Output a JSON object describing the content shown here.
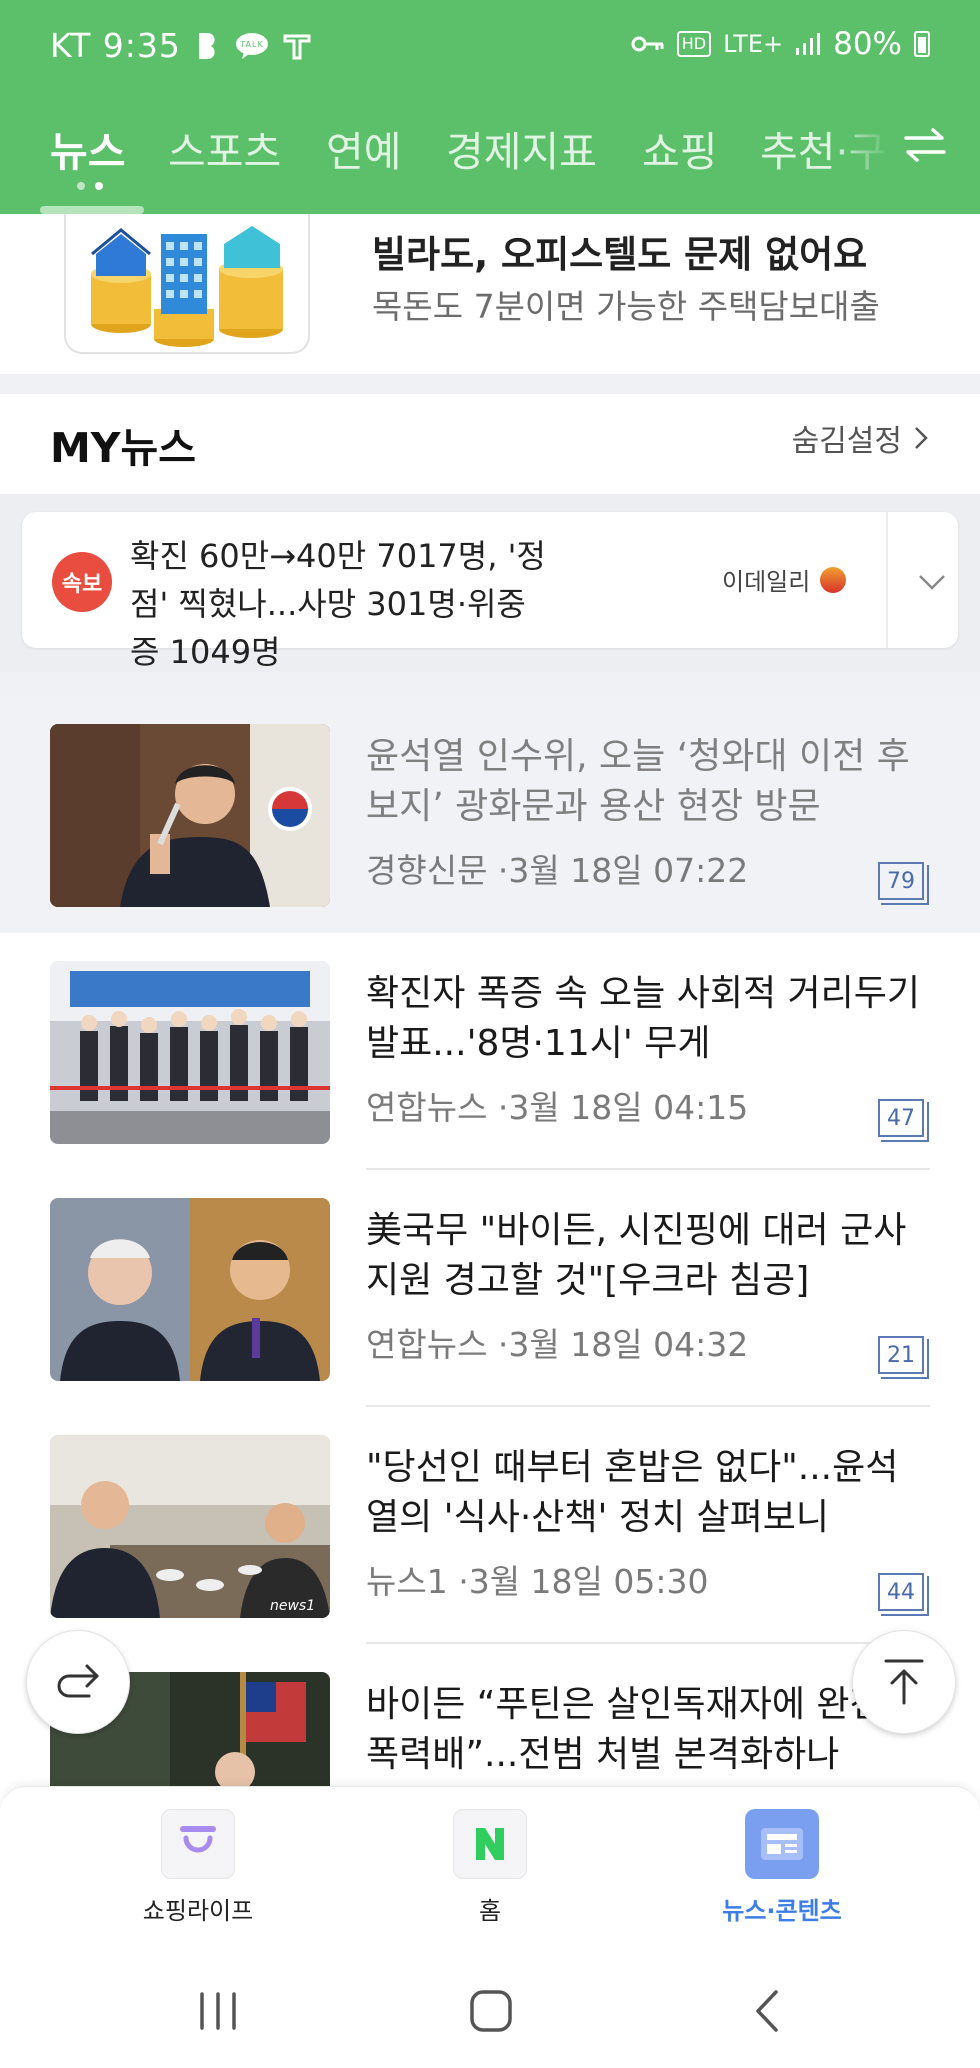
{
  "status_bar": {
    "carrier_time": "KT 9:35",
    "network": "LTE+",
    "hd": "HD",
    "battery": "80%"
  },
  "top_tabs": [
    {
      "label": "뉴스",
      "active": true
    },
    {
      "label": "스포츠",
      "active": false
    },
    {
      "label": "연예",
      "active": false
    },
    {
      "label": "경제지표",
      "active": false
    },
    {
      "label": "쇼핑",
      "active": false
    },
    {
      "label": "추천·구",
      "active": false
    }
  ],
  "ad": {
    "title": "빌라도, 오피스텔도 문제 없어요",
    "subtitle": "목돈도 7분이면 가능한 주택담보대출"
  },
  "my_news": {
    "title": "MY뉴스",
    "hide_setting": "숨김설정"
  },
  "breaking": {
    "badge": "속보",
    "headline": "확진 60만→40만 7017명, '정점' 찍혔나...사망 301명·위중증 1049명",
    "press": "이데일리"
  },
  "news": [
    {
      "title": "윤석열 인수위, 오늘 ‘청와대 이전 후보지’ 광화문과 용산 현장 방문",
      "meta": "경향신문 ·3월 18일 07:22",
      "comments": "79",
      "read": true
    },
    {
      "title": "확진자 폭증 속 오늘 사회적 거리두기 발표...'8명·11시' 무게",
      "meta": "연합뉴스 ·3월 18일 04:15",
      "comments": "47",
      "read": false
    },
    {
      "title": "美국무 \"바이든, 시진핑에 대러 군사지원 경고할 것\"[우크라 침공]",
      "meta": "연합뉴스 ·3월 18일 04:32",
      "comments": "21",
      "read": false
    },
    {
      "title": "\"당선인 때부터 혼밥은 없다\"...윤석열의 '식사·산책' 정치 살펴보니",
      "meta": "뉴스1 ·3월 18일 05:30",
      "comments": "44",
      "read": false
    },
    {
      "title": "바이든 “푸틴은 살인독재자에 완전한 폭력배”...전범 처벌 본격화하나",
      "meta": "",
      "comments": "",
      "read": false
    }
  ],
  "bottom_nav": [
    {
      "label": "쇼핑라이프",
      "icon": "shopping-life-icon",
      "active": false
    },
    {
      "label": "홈",
      "icon": "naver-home-icon",
      "active": false
    },
    {
      "label": "뉴스·콘텐츠",
      "icon": "news-content-icon",
      "active": true
    }
  ],
  "colors": {
    "header_green": "#5cc06a",
    "breaking_red": "#e94d3f",
    "active_blue": "#3d7ee6"
  }
}
